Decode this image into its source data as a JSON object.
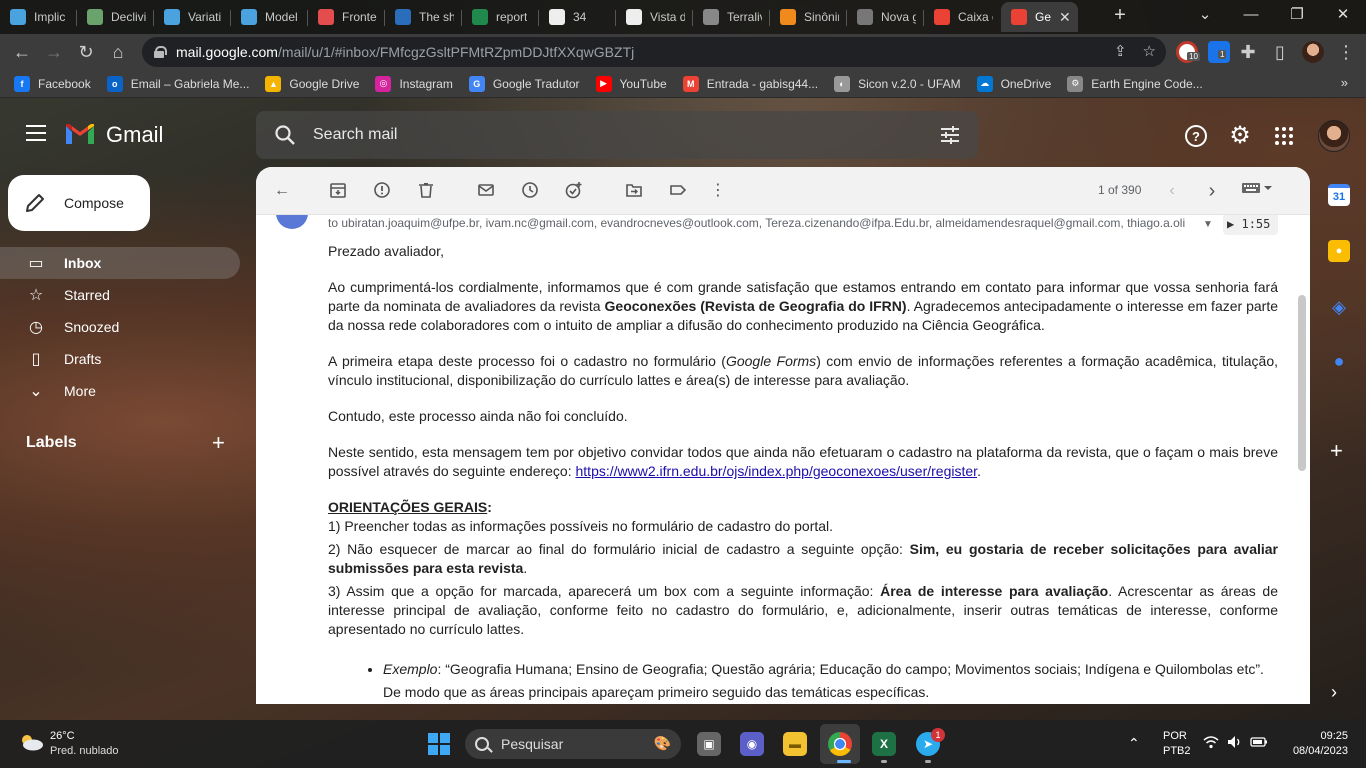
{
  "browser": {
    "tabs": [
      {
        "title": "Implic",
        "icon": "wave-icon",
        "color": "#4aa3df"
      },
      {
        "title": "Declivi",
        "icon": "camera-icon",
        "color": "#6aa36b"
      },
      {
        "title": "Variati",
        "icon": "wave-icon",
        "color": "#4aa3df"
      },
      {
        "title": "Model",
        "icon": "wave-icon",
        "color": "#4aa3df"
      },
      {
        "title": "Fronte",
        "icon": "pinwheel-icon",
        "color": "#e34d4d"
      },
      {
        "title": "The sha",
        "icon": "wordpress-icon",
        "color": "#2a6ebb"
      },
      {
        "title": "report",
        "icon": "chart-icon",
        "color": "#1f8a4c"
      },
      {
        "title": "34",
        "icon": "dnb-icon",
        "color": "#eeeeee"
      },
      {
        "title": "Vista d",
        "icon": "pkp-icon",
        "color": "#eeeeee"
      },
      {
        "title": "Terraliv",
        "icon": "globe-icon",
        "color": "#888888"
      },
      {
        "title": "Sinônir",
        "icon": "dots-icon",
        "color": "#f08a1c"
      },
      {
        "title": "Nova g",
        "icon": "loading-icon",
        "color": "#777777"
      },
      {
        "title": "Caixa d",
        "icon": "gmail-icon",
        "color": "#ea4335"
      },
      {
        "title": "Ge",
        "icon": "gmail-icon",
        "color": "#ea4335",
        "active": true
      }
    ],
    "url_host": "mail.google.com",
    "url_path": "/mail/u/1/#inbox/FMfcgzGsltPFMtRZpmDDJtfXXqwGBZTj",
    "extensions": [
      {
        "badge": "10",
        "color": "#c0392b"
      },
      {
        "badge": "1",
        "color": "#1a73e8"
      }
    ],
    "bookmarks": [
      {
        "label": "Facebook",
        "icon": "facebook-icon",
        "color": "#1877f2",
        "glyph": "f"
      },
      {
        "label": "Email – Gabriela Me...",
        "icon": "outlook-icon",
        "color": "#0a64c8",
        "glyph": "o"
      },
      {
        "label": "Google Drive",
        "icon": "drive-icon",
        "color": "#f4b400",
        "glyph": "▲"
      },
      {
        "label": "Instagram",
        "icon": "instagram-icon",
        "color": "#d6249f",
        "glyph": "◎"
      },
      {
        "label": "Google Tradutor",
        "icon": "translate-icon",
        "color": "#4285f4",
        "glyph": "G"
      },
      {
        "label": "YouTube",
        "icon": "youtube-icon",
        "color": "#ff0000",
        "glyph": "▶"
      },
      {
        "label": "Entrada - gabisg44...",
        "icon": "gmail-icon",
        "color": "#ea4335",
        "glyph": "M"
      },
      {
        "label": "Sicon v.2.0 - UFAM",
        "icon": "globe-icon",
        "color": "#999999",
        "glyph": "◐"
      },
      {
        "label": "OneDrive",
        "icon": "onedrive-icon",
        "color": "#0078d4",
        "glyph": "☁"
      },
      {
        "label": "Earth Engine Code...",
        "icon": "gear-icon",
        "color": "#888888",
        "glyph": "⚙"
      }
    ],
    "bookmarks_more": "»"
  },
  "gmail": {
    "product_name": "Gmail",
    "search_placeholder": "Search mail",
    "compose_label": "Compose",
    "nav": [
      {
        "label": "Inbox",
        "icon": "inbox-icon",
        "active": true
      },
      {
        "label": "Starred",
        "icon": "star-icon"
      },
      {
        "label": "Snoozed",
        "icon": "clock-icon"
      },
      {
        "label": "Drafts",
        "icon": "draft-icon"
      },
      {
        "label": "More",
        "icon": "chevron-down-icon"
      }
    ],
    "labels_heading": "Labels",
    "pager": "1 of 390"
  },
  "message": {
    "to_line": "to ubiratan.joaquim@ufpe.br, ivam.nc@gmail.com, evandrocneves@outlook.com, Tereza.cizenando@ifpa.Edu.br, almeidamendesraquel@gmail.com, thiago.a.oli",
    "audio_time": "1:55",
    "greeting": "Prezado avaliador,",
    "p1_start": "Ao cumprimentá-los cordialmente, informamos que é com grande satisfação que estamos entrando em contato para informar que vossa senhoria fará parte da nominata de avaliadores da revista ",
    "p1_bold": "Geoconexões (Revista de Geografia do IFRN)",
    "p1_end": ". Agradecemos antecipadamente o interesse em fazer parte da nossa rede colaboradores com o intuito de ampliar a difusão do conhecimento produzido na Ciência Geográfica.",
    "p2_start": "A primeira etapa deste processo foi o cadastro no formulário (",
    "p2_italic": "Google Forms",
    "p2_end": ") com envio de informações referentes a formação acadêmica, titulação, vínculo institucional, disponibilização do currículo lattes e área(s) de interesse para avaliação.",
    "p3": "Contudo, este processo ainda não foi concluído.",
    "p4_start": "Neste sentido, esta mensagem tem por objetivo convidar todos que ainda não efetuaram o cadastro na plataforma da revista, que o façam o mais breve possível através do seguinte endereço: ",
    "p4_link": "https://www2.ifrn.edu.br/ojs/index.php/geoconexoes/user/register",
    "p4_end": ".",
    "heading": "ORIENTAÇÕES GERAIS",
    "heading_colon": ":",
    "item1": "1) Preencher todas as informações possíveis no formulário de cadastro do portal.",
    "item2_start": "2) Não esquecer de marcar ao final do formulário inicial de cadastro a seguinte opção: ",
    "item2_bold": "Sim, eu gostaria de receber solicitações para avaliar submissões para esta revista",
    "item2_end": ".",
    "item3_start": "3) Assim que a opção for marcada, aparecerá um box com a seguinte informação: ",
    "item3_bold": "Área de interesse para avaliação",
    "item3_end": ". Acrescentar as áreas de interesse principal de avaliação, conforme feito no cadastro do formulário, e, adicionalmente, inserir outras temáticas de interesse, conforme apresentado no currículo lattes.",
    "bullet_italic": "Exemplo",
    "bullet_text": ": “Geografia Humana; Ensino de Geografia; Questão agrária; Educação do campo; Movimentos sociais; Indígena e Quilombolas etc”. De modo que as áreas principais apareçam primeiro seguido das temáticas específicas."
  },
  "taskbar": {
    "temperature": "26°C",
    "weather": "Pred. nublado",
    "search_label": "Pesquisar",
    "telegram_badge": "1",
    "lang_top": "POR",
    "lang_bottom": "PTB2",
    "time": "09:25",
    "date": "08/04/2023"
  }
}
